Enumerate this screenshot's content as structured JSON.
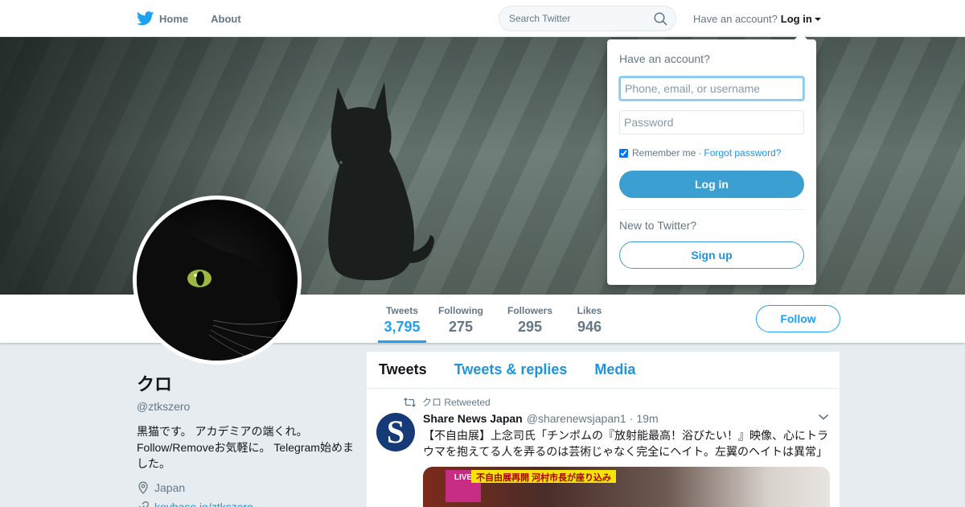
{
  "nav": {
    "home_label": "Home",
    "about_label": "About",
    "search_placeholder": "Search Twitter",
    "have_account": "Have an account?",
    "login_label": "Log in"
  },
  "profile": {
    "name": "クロ",
    "handle": "@ztkszero",
    "bio": "黒猫です。 アカデミアの端くれ。 Follow/Removeお気軽に。 Telegram始めました。",
    "location": "Japan",
    "link": "keybase.io/ztkszero"
  },
  "stats": [
    {
      "label": "Tweets",
      "value": "3,795"
    },
    {
      "label": "Following",
      "value": "275"
    },
    {
      "label": "Followers",
      "value": "295"
    },
    {
      "label": "Likes",
      "value": "946"
    }
  ],
  "follow_label": "Follow",
  "timeline": {
    "tabs": [
      "Tweets",
      "Tweets & replies",
      "Media"
    ],
    "tweet": {
      "retweeted_by": "クロ Retweeted",
      "avatar_letter": "S",
      "author_name": "Share News Japan",
      "author_handle": "@sharenewsjapan1",
      "separator": "·",
      "time": "19m",
      "text": "【不自由展】上念司氏「チンポムの『放射能最高！浴びたい！』映像、心にトラウマを抱えてる人を弄るのは芸術じゃなく完全にヘイト。左翼のヘイトは異常」",
      "media_caption": "不自由展再開 河村市長が座り込み",
      "media_badge": "LIVE"
    }
  },
  "login_dropdown": {
    "title": "Have an account?",
    "username_placeholder": "Phone, email, or username",
    "password_placeholder": "Password",
    "remember_label": "Remember me",
    "separator": "·",
    "forgot_label": "Forgot password?",
    "login_button": "Log in",
    "new_to_twitter": "New to Twitter?",
    "signup_button": "Sign up"
  },
  "colors": {
    "accent": "#1da1f2",
    "link": "#1b95e0",
    "login_button": "#3b9fd1",
    "muted_text": "#657786",
    "page_background": "#e6ecf0"
  }
}
